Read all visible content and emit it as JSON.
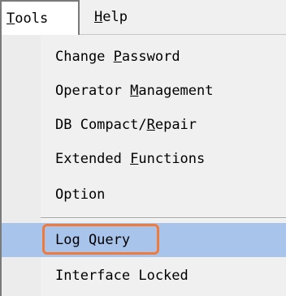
{
  "menubar": {
    "tools": {
      "prefix": "",
      "accel": "T",
      "rest": "ools"
    },
    "help": {
      "prefix": "",
      "accel": "H",
      "rest": "elp"
    }
  },
  "menu": {
    "items": [
      {
        "prefix": "Change ",
        "accel": "P",
        "rest": "assword"
      },
      {
        "prefix": "Operator ",
        "accel": "M",
        "rest": "anagement"
      },
      {
        "prefix": "DB Compact/",
        "accel": "R",
        "rest": "epair"
      },
      {
        "prefix": "Extended ",
        "accel": "F",
        "rest": "unctions"
      },
      {
        "prefix": "Option",
        "accel": "",
        "rest": ""
      },
      {
        "prefix": "Log Query",
        "accel": "",
        "rest": ""
      },
      {
        "prefix": "Interface Locked",
        "accel": "",
        "rest": ""
      }
    ],
    "selected_index": 5
  },
  "colors": {
    "selection": "#a9c4ea",
    "callout": "#f07a3c"
  }
}
